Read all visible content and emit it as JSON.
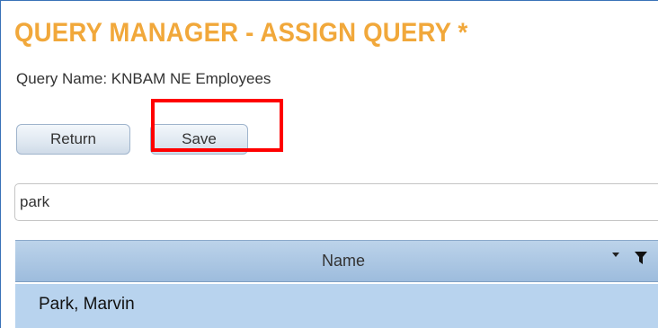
{
  "page": {
    "title": "QUERY MANAGER - ASSIGN QUERY *",
    "query_name": "Query Name: KNBAM NE Employees"
  },
  "toolbar": {
    "return_label": "Return",
    "save_label": "Save"
  },
  "search": {
    "value": "park"
  },
  "grid": {
    "columns": [
      "Name"
    ],
    "rows": [
      {
        "name": "Park, Marvin"
      }
    ]
  },
  "colors": {
    "title": "#f1a83b",
    "highlight": "#ff0000",
    "header_bg": "#9dbcdd",
    "row_selected_bg": "#b8d3ee",
    "frame_border": "#3a72b8"
  },
  "icons": {
    "sort": "caret-down-icon",
    "filter": "filter-icon"
  }
}
